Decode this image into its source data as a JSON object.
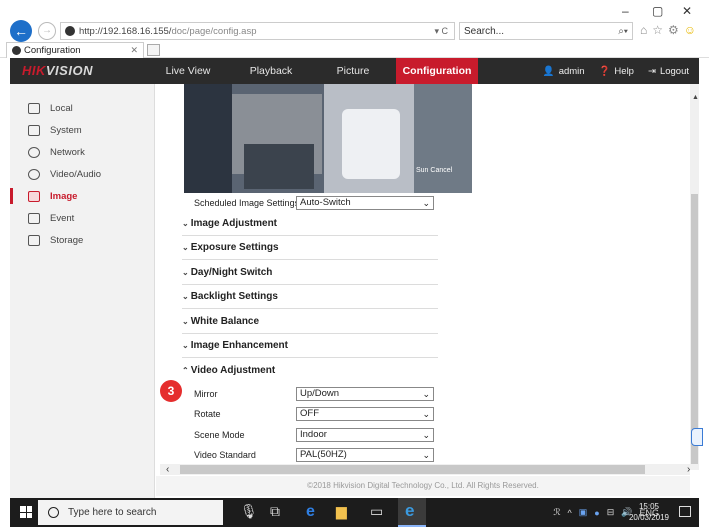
{
  "browser": {
    "url_host": "http://192.168.16.155/",
    "url_path": "doc/page/config.asp",
    "address_buttons": "▾ C",
    "search_placeholder": "Search...",
    "tab_title": "Configuration",
    "window_controls": [
      "–",
      "▢",
      "✕"
    ]
  },
  "app": {
    "logo_brand": "HIK",
    "logo_rest": "VISION",
    "nav": [
      "Live View",
      "Playback",
      "Picture",
      "Configuration"
    ],
    "active_nav": "Configuration",
    "user": "admin",
    "help": "Help",
    "logout": "Logout"
  },
  "sidebar": {
    "items": [
      {
        "label": "Local",
        "icon": "monitor-icon"
      },
      {
        "label": "System",
        "icon": "system-icon"
      },
      {
        "label": "Network",
        "icon": "network-icon"
      },
      {
        "label": "Video/Audio",
        "icon": "video-audio-icon"
      },
      {
        "label": "Image",
        "icon": "image-icon",
        "active": true
      },
      {
        "label": "Event",
        "icon": "event-icon"
      },
      {
        "label": "Storage",
        "icon": "storage-icon"
      }
    ]
  },
  "main": {
    "osd_text": "Sun Cancel",
    "scheduled_label": "Scheduled Image Settings",
    "scheduled_value": "Auto-Switch",
    "sections": [
      {
        "label": "Image Adjustment",
        "expanded": false
      },
      {
        "label": "Exposure Settings",
        "expanded": false
      },
      {
        "label": "Day/Night Switch",
        "expanded": false
      },
      {
        "label": "Backlight Settings",
        "expanded": false
      },
      {
        "label": "White Balance",
        "expanded": false
      },
      {
        "label": "Image Enhancement",
        "expanded": false
      },
      {
        "label": "Video Adjustment",
        "expanded": true
      }
    ],
    "video_adjustment": [
      {
        "label": "Mirror",
        "value": "Up/Down"
      },
      {
        "label": "Rotate",
        "value": "OFF"
      },
      {
        "label": "Scene Mode",
        "value": "Indoor"
      },
      {
        "label": "Video Standard",
        "value": "PAL(50HZ)"
      }
    ],
    "step_badge": "3",
    "footer": "©2018 Hikvision Digital Technology Co., Ltd. All Rights Reserved."
  },
  "taskbar": {
    "search_placeholder": "Type here to search",
    "language": "ENG",
    "time": "15:05",
    "date": "20/03/2019"
  }
}
